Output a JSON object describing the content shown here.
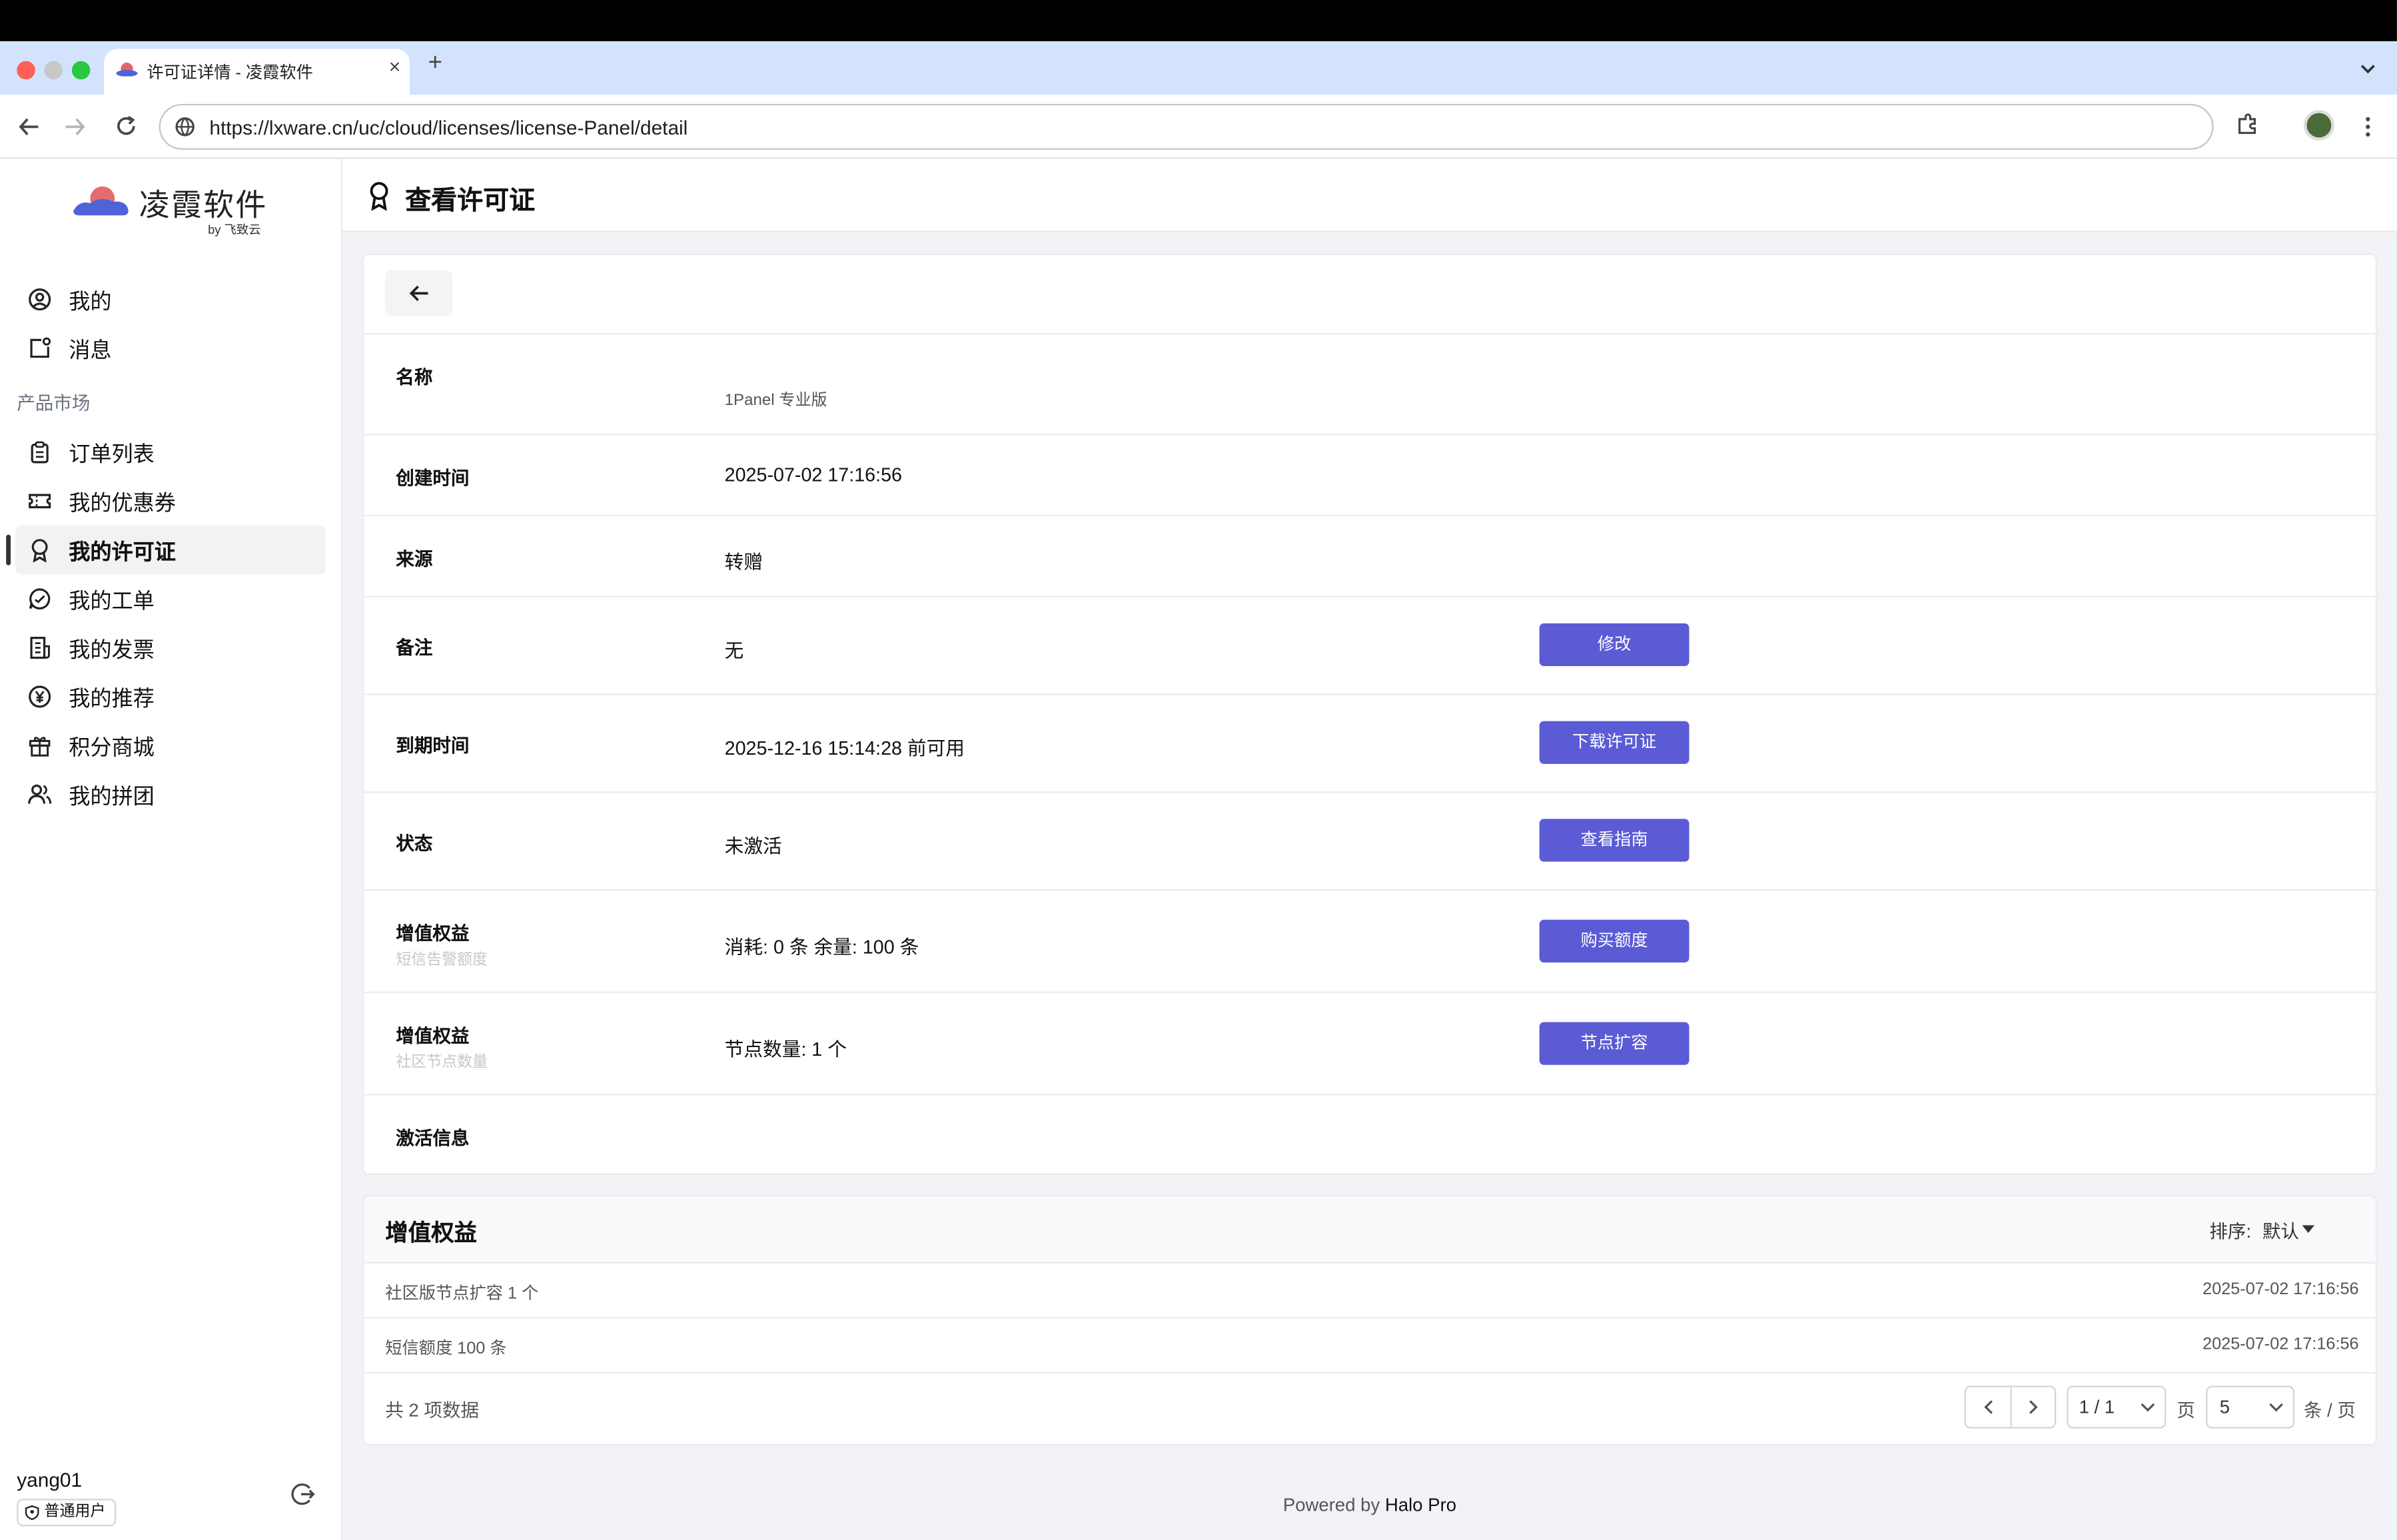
{
  "browser": {
    "tab_title": "许可证详情 - 凌霞软件",
    "new_tab": "+",
    "close_tab": "×",
    "url": "https://lxware.cn/uc/cloud/licenses/license-Panel/detail"
  },
  "sidebar": {
    "brand": "凌霞软件",
    "brand_by": "by 飞致云",
    "items_top": [
      {
        "label": "我的",
        "icon": "user-circle-icon"
      },
      {
        "label": "消息",
        "icon": "message-icon"
      }
    ],
    "section_label": "产品市场",
    "items": [
      {
        "label": "订单列表",
        "icon": "clipboard-icon"
      },
      {
        "label": "我的优惠券",
        "icon": "ticket-icon"
      },
      {
        "label": "我的许可证",
        "icon": "award-icon",
        "active": true
      },
      {
        "label": "我的工单",
        "icon": "chat-icon"
      },
      {
        "label": "我的发票",
        "icon": "invoice-icon"
      },
      {
        "label": "我的推荐",
        "icon": "yen-icon"
      },
      {
        "label": "积分商城",
        "icon": "gift-icon"
      },
      {
        "label": "我的拼团",
        "icon": "users-icon"
      }
    ],
    "user": {
      "name": "yang01",
      "role": "普通用户"
    }
  },
  "page": {
    "title": "查看许可证",
    "rows": [
      {
        "label": "名称",
        "value": "1Panel 专业版"
      },
      {
        "label": "创建时间",
        "value": "2025-07-02 17:16:56"
      },
      {
        "label": "来源",
        "value": "转赠"
      },
      {
        "label": "备注",
        "value": "无",
        "button": "修改"
      },
      {
        "label": "到期时间",
        "value": "2025-12-16 15:14:28 前可用",
        "button": "下载许可证"
      },
      {
        "label": "状态",
        "value": "未激活",
        "button": "查看指南"
      },
      {
        "label": "增值权益",
        "sub": "短信告警额度",
        "value": "消耗: 0 条 余量: 100 条",
        "button": "购买额度"
      },
      {
        "label": "增值权益",
        "sub": "社区节点数量",
        "value": "节点数量: 1 个",
        "button": "节点扩容"
      },
      {
        "label": "激活信息",
        "value": ""
      }
    ]
  },
  "benefits": {
    "title": "增值权益",
    "sort_label": "排序:",
    "sort_value": "默认",
    "items": [
      {
        "name": "社区版节点扩容 1 个",
        "time": "2025-07-02 17:16:56"
      },
      {
        "name": "短信额度 100 条",
        "time": "2025-07-02 17:16:56"
      }
    ],
    "total": "共 2 项数据",
    "page_indicator": "1 / 1",
    "page_unit": "页",
    "page_size": "5",
    "page_size_unit": "条 / 页"
  },
  "footer": {
    "prefix": "Powered by",
    "brand": "Halo Pro"
  },
  "colors": {
    "primary": "#5b5bd6",
    "tabstrip": "#d3e3fd",
    "background": "#f1f3f6"
  }
}
